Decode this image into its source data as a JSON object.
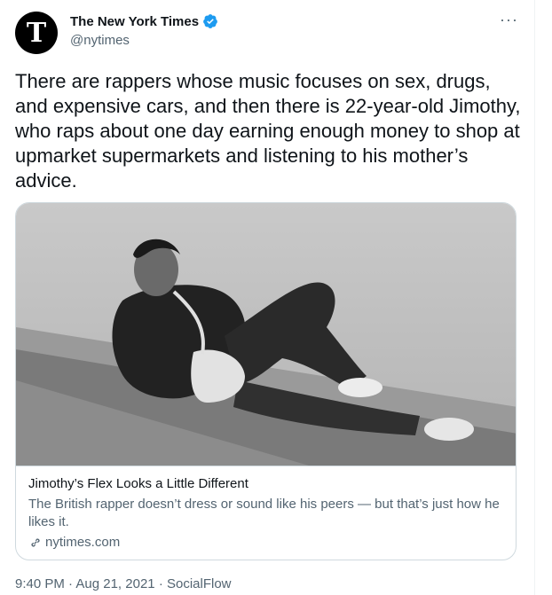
{
  "author": {
    "display_name": "The New York Times",
    "handle": "@nytimes",
    "avatar_letter": "T",
    "verified": true,
    "verified_color": "#1d9bf0"
  },
  "more_label": "···",
  "tweet": {
    "text": "There are rappers whose music focuses on sex, drugs, and expensive cars, and then there is 22-year-old Jimothy, who raps about one day earning enough money to shop at upmarket supermarkets and listening to his mother’s advice."
  },
  "card": {
    "image_icon": "photo-young-man-reclining-on-pavement",
    "title": "Jimothy’s Flex Looks a Little Different",
    "description": "The British rapper doesn’t dress or sound like his peers — but that’s just how he likes it.",
    "domain": "nytimes.com"
  },
  "meta": {
    "time": "9:40 PM",
    "date": "Aug 21, 2021",
    "source": "SocialFlow",
    "separator": "·"
  }
}
